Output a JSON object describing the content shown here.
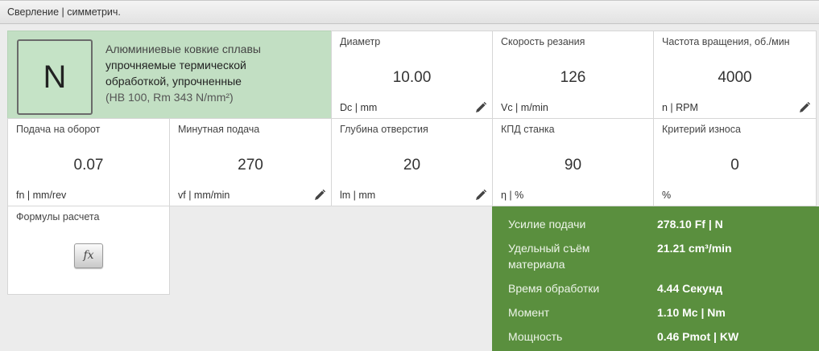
{
  "header": {
    "title": "Сверление | симметрич."
  },
  "material": {
    "group": "N",
    "line1": "Алюминиевые ковкие сплавы",
    "line2": "упрочняемые термической",
    "line3": "обработкой, упрочненные",
    "line4": "(HB 100, Rm 343 N/mm²)"
  },
  "params": {
    "diameter": {
      "label": "Диаметр",
      "value": "10.00",
      "unit": "Dc | mm"
    },
    "cutting_speed": {
      "label": "Скорость резания",
      "value": "126",
      "unit": "Vc | m/min"
    },
    "spindle_speed": {
      "label": "Частота вращения, об./мин",
      "value": "4000",
      "unit": "n | RPM"
    },
    "feed_per_rev": {
      "label": "Подача на оборот",
      "value": "0.07",
      "unit": "fn | mm/rev"
    },
    "feed_per_min": {
      "label": "Минутная подача",
      "value": "270",
      "unit": "vf | mm/min"
    },
    "hole_depth": {
      "label": "Глубина отверстия",
      "value": "20",
      "unit": "lm | mm"
    },
    "efficiency": {
      "label": "КПД станка",
      "value": "90",
      "unit": "η | %"
    },
    "wear": {
      "label": "Критерий износа",
      "value": "0",
      "unit": "%"
    }
  },
  "formulas": {
    "label": "Формулы расчета",
    "button": "fx"
  },
  "results": [
    {
      "label": "Усилие подачи",
      "value": "278.10 Ff | N"
    },
    {
      "label": "Удельный съём материала",
      "value": "21.21 cm³/min"
    },
    {
      "label": "Время обработки",
      "value": "4.44 Секунд"
    },
    {
      "label": "Момент",
      "value": "1.10 Mc | Nm"
    },
    {
      "label": "Мощность",
      "value": "0.46 Pmot | KW"
    }
  ],
  "colors": {
    "material_bg": "#c2dfc3",
    "results_bg": "#5a8f3e"
  },
  "icons": {
    "edit": "pencil-icon"
  }
}
